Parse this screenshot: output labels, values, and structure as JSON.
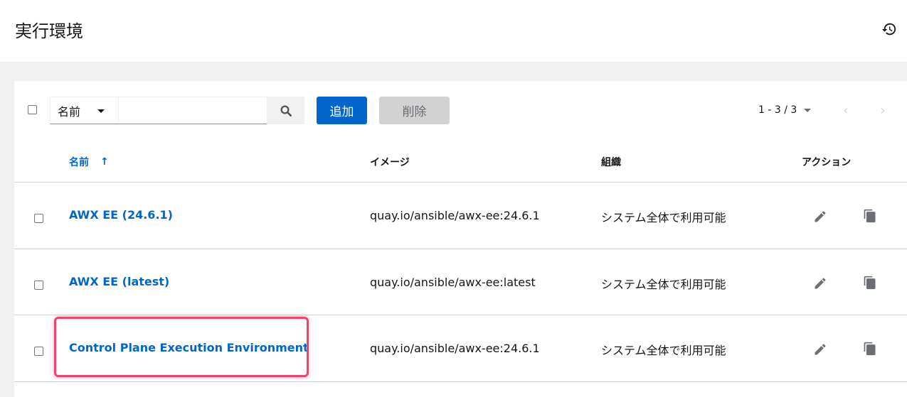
{
  "header": {
    "title": "実行環境",
    "history_icon": "history-icon"
  },
  "toolbar": {
    "filter_select_value": "名前",
    "search_placeholder": "",
    "search_icon": "search-icon",
    "add_label": "追加",
    "delete_label": "削除",
    "pagination": "1 - 3 / 3"
  },
  "table": {
    "columns": {
      "name": "名前",
      "image": "イメージ",
      "organization": "組織",
      "actions": "アクション"
    },
    "rows": [
      {
        "name": "AWX EE (24.6.1)",
        "image": "quay.io/ansible/awx-ee:24.6.1",
        "organization": "システム全体で利用可能"
      },
      {
        "name": "AWX EE (latest)",
        "image": "quay.io/ansible/awx-ee:latest",
        "organization": "システム全体で利用可能"
      },
      {
        "name": "Control Plane Execution Environment",
        "image": "quay.io/ansible/awx-ee:24.6.1",
        "organization": "システム全体で利用可能"
      }
    ]
  },
  "colors": {
    "link": "#0066cc",
    "primary_button": "#0066cc",
    "highlight": "#f2426e"
  }
}
